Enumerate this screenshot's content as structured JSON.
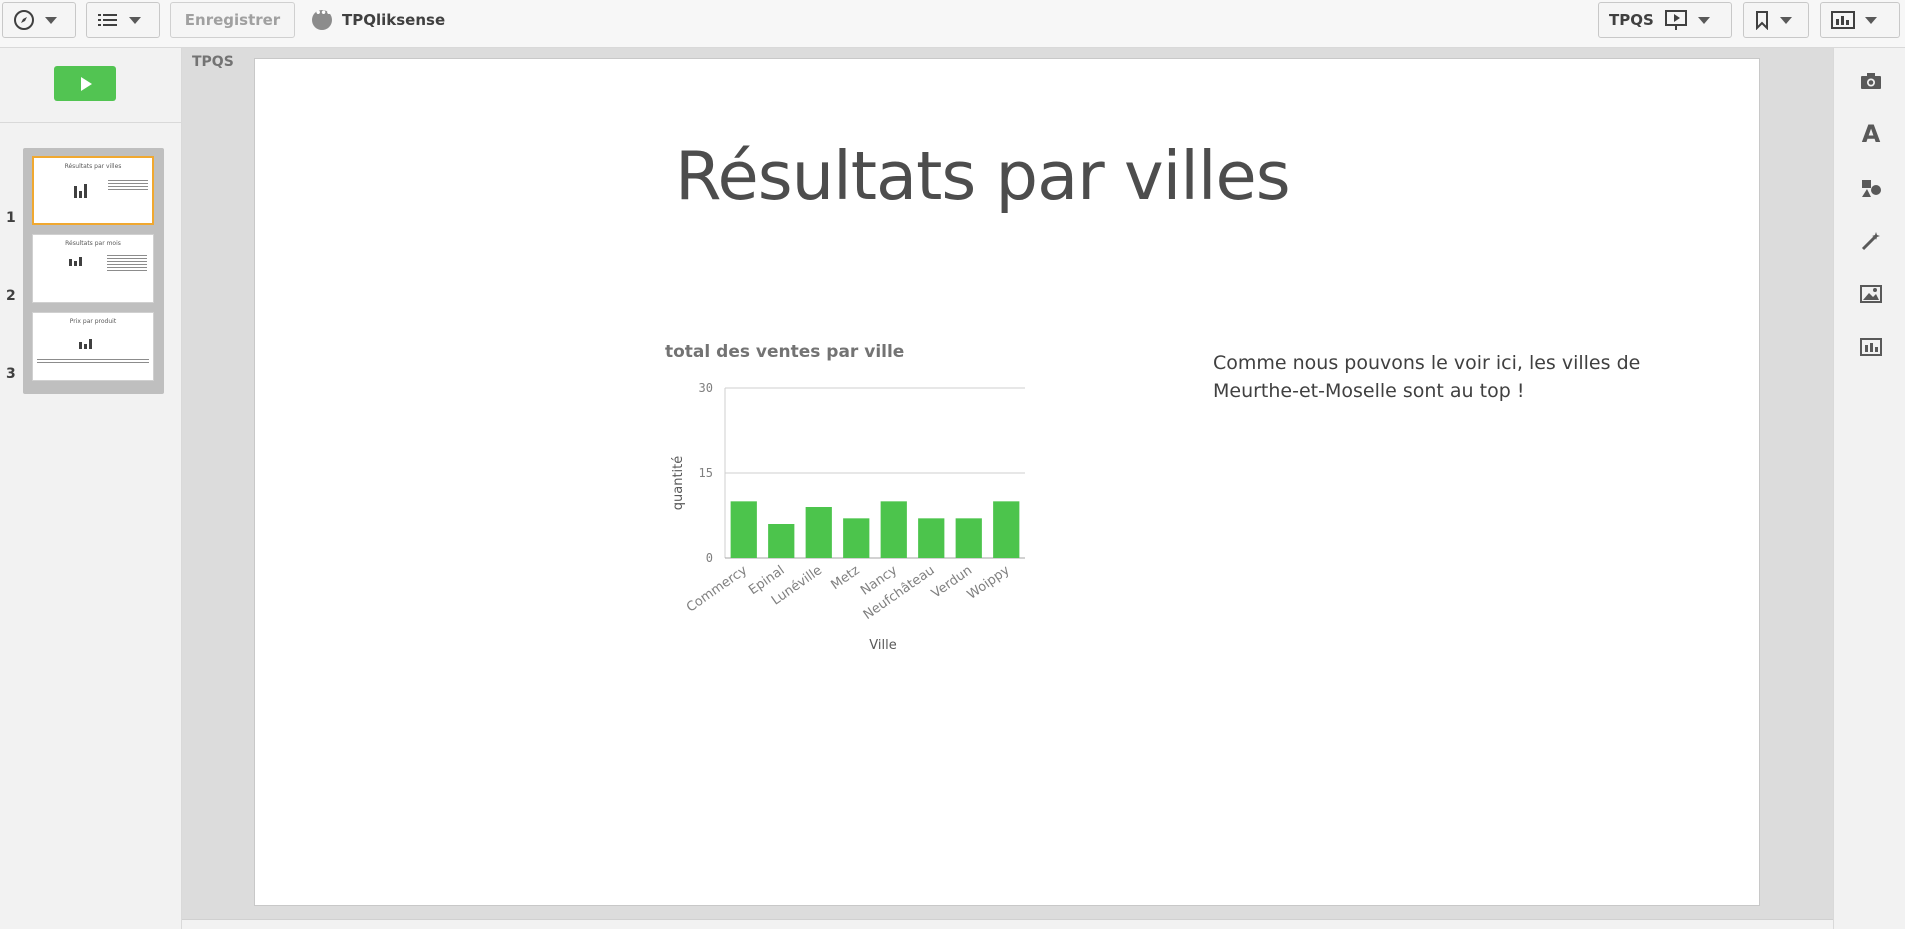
{
  "toolbar": {
    "save_label": "Enregistrer",
    "app_name": "TPQliksense",
    "sheet_selector_label": "TPQS"
  },
  "story": {
    "slides": [
      {
        "number": "1",
        "title": "Résultats par villes",
        "active": true
      },
      {
        "number": "2",
        "title": "Résultats par mois",
        "active": false
      },
      {
        "number": "3",
        "title": "Prix par produit",
        "active": false
      }
    ]
  },
  "canvas": {
    "sheet_label": "TPQS",
    "slide_title": "Résultats par villes",
    "slide_text": "Comme nous pouvons le voir ici, les villes de Meurthe-et-Moselle sont au top !"
  },
  "chart_data": {
    "type": "bar",
    "title": "total des ventes par ville",
    "xlabel": "Ville",
    "ylabel": "quantité",
    "categories": [
      "Commercy",
      "Epinal",
      "Lunéville",
      "Metz",
      "Nancy",
      "Neufchâteau",
      "Verdun",
      "Woippy"
    ],
    "values": [
      10,
      6,
      9,
      7,
      10,
      7,
      7,
      10
    ],
    "ylim": [
      0,
      30
    ],
    "yticks": [
      "30",
      "15",
      "0"
    ],
    "bar_color": "#4cc44c",
    "grid": true
  },
  "icons": {
    "right_tools": [
      "camera-icon",
      "text-icon",
      "shapes-icon",
      "effects-wand-icon",
      "image-icon",
      "chart-icon"
    ]
  },
  "colors": {
    "play_button": "#52c452",
    "active_thumb_border": "#f0a830"
  }
}
